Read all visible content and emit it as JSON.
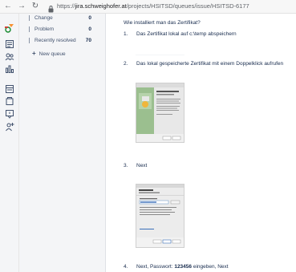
{
  "browser": {
    "url_host": "jira.schweighofer.at",
    "url_path": "/projects/HSITSD/queues/issue/HSITSD-6177",
    "url_scheme": "https://"
  },
  "rail": {
    "icons": [
      "jira-logo-icon",
      "board-icon",
      "customers-icon",
      "reports-icon",
      "knowledge-base-icon",
      "page-icon",
      "notification-icon",
      "add-people-icon"
    ]
  },
  "queues": {
    "items": [
      {
        "label": "Change",
        "count": "0"
      },
      {
        "label": "Problem",
        "count": "0"
      },
      {
        "label": "Recently resolved",
        "count": "70"
      }
    ],
    "new_queue": "New queue"
  },
  "article": {
    "heading": "Wie installiert man das Zertifikat?",
    "steps": [
      {
        "num": "1.",
        "text": "Das Zertifikat lokal auf c:\\temp abspeichern"
      },
      {
        "num": "2.",
        "text": "Das lokal gespeicherte Zertifikat mit einem Doppelklick aufrufen"
      },
      {
        "num": "3.",
        "text": "Next"
      },
      {
        "num": "4.",
        "text_before": "Next, Passwort: ",
        "text_bold": "123456",
        "text_after": " eingeben, Next"
      }
    ]
  },
  "colors": {
    "sidebar_bg": "#f4f5f7",
    "text": "#172b4d",
    "link": "#0052cc",
    "logo_orange": "#f79232",
    "logo_green": "#14892c"
  }
}
